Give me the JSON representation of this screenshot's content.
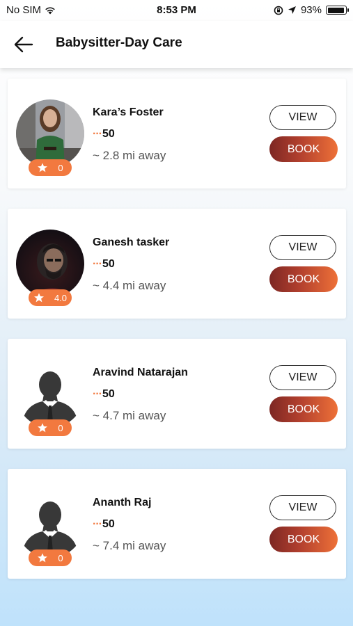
{
  "status_bar": {
    "carrier": "No SIM",
    "time": "8:53 PM",
    "battery": "93%",
    "battery_level": 0.93
  },
  "header": {
    "title": "Babysitter-Day Care"
  },
  "colors": {
    "accent": "#f2793f",
    "book_gradient_start": "#7d2723",
    "book_gradient_end": "#ee7138"
  },
  "providers": [
    {
      "name": "Kara’s Foster",
      "rating": "0",
      "price_prefix": "···",
      "price": "50",
      "distance": "~ 2.8 mi away",
      "view_label": "VIEW",
      "book_label": "BOOK",
      "avatar": "photo-woman"
    },
    {
      "name": "Ganesh tasker",
      "rating": "4.0",
      "price_prefix": "···",
      "price": "50",
      "distance": "~ 4.4 mi away",
      "view_label": "VIEW",
      "book_label": "BOOK",
      "avatar": "photo-man"
    },
    {
      "name": "Aravind Natarajan",
      "rating": "0",
      "price_prefix": "···",
      "price": "50",
      "distance": "~ 4.7 mi away",
      "view_label": "VIEW",
      "book_label": "BOOK",
      "avatar": "default-silhouette"
    },
    {
      "name": "Ananth Raj",
      "rating": "0",
      "price_prefix": "···",
      "price": "50",
      "distance": "~ 7.4 mi away",
      "view_label": "VIEW",
      "book_label": "BOOK",
      "avatar": "default-silhouette"
    }
  ]
}
